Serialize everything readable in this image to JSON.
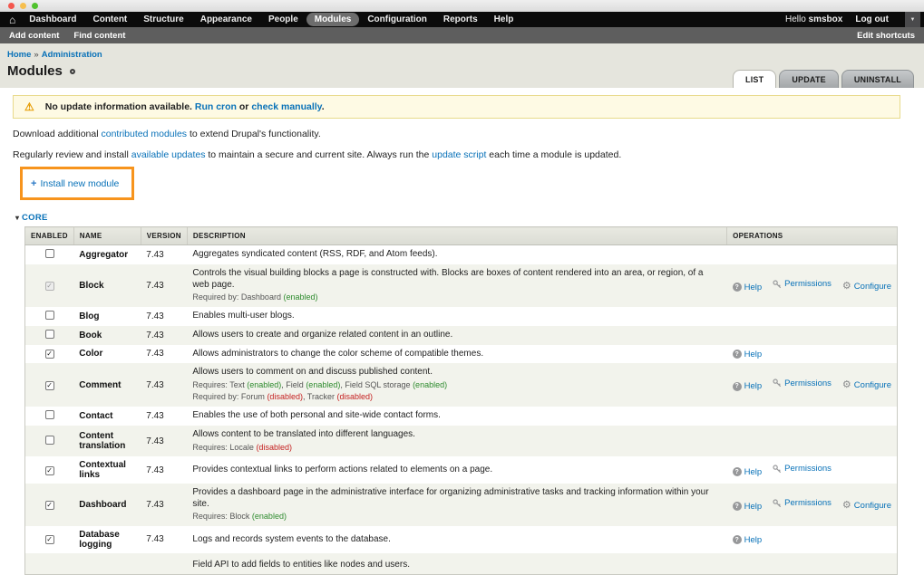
{
  "window": {
    "controls": [
      "close",
      "minimize",
      "maximize"
    ]
  },
  "icons": {
    "home": "⌂",
    "dropdown_caret": "▼",
    "warning": "⚠",
    "breadcrumb_separator": "»",
    "collapse_arrow": "▾",
    "help_glyph": "?",
    "gear_glyph": "⚙",
    "plus": "+"
  },
  "toolbar": {
    "items": [
      {
        "label": "Dashboard",
        "active": false
      },
      {
        "label": "Content",
        "active": false
      },
      {
        "label": "Structure",
        "active": false
      },
      {
        "label": "Appearance",
        "active": false
      },
      {
        "label": "People",
        "active": false
      },
      {
        "label": "Modules",
        "active": true
      },
      {
        "label": "Configuration",
        "active": false
      },
      {
        "label": "Reports",
        "active": false
      },
      {
        "label": "Help",
        "active": false
      }
    ],
    "greeting_prefix": "Hello ",
    "username": "smsbox",
    "logout_label": "Log out"
  },
  "shortcut_bar": {
    "items": [
      "Add content",
      "Find content"
    ],
    "edit_label": "Edit shortcuts"
  },
  "breadcrumb": {
    "items": [
      "Home",
      "Administration"
    ],
    "separator": "»"
  },
  "page": {
    "title": "Modules"
  },
  "tabs": [
    {
      "label": "LIST",
      "active": true
    },
    {
      "label": "UPDATE",
      "active": false
    },
    {
      "label": "UNINSTALL",
      "active": false
    }
  ],
  "warning": {
    "text": "No update information available. ",
    "link1": "Run cron",
    "middle": " or ",
    "link2": "check manually",
    "end": "."
  },
  "intro": {
    "p1_pre": "Download additional ",
    "p1_link": "contributed modules",
    "p1_post": " to extend Drupal's functionality.",
    "p2_pre": "Regularly review and install ",
    "p2_link1": "available updates",
    "p2_mid": " to maintain a secure and current site. Always run the ",
    "p2_link2": "update script",
    "p2_post": " each time a module is updated."
  },
  "install_button": {
    "label": "Install new module"
  },
  "core_section": {
    "label": "CORE",
    "collapsed": false
  },
  "colors": {
    "link_blue": "#0871b8",
    "enabled_green": "#2e8b2e",
    "disabled_red": "#c52222",
    "highlight_orange": "#f7941d",
    "warning_bg": "#fefae4"
  },
  "table": {
    "headers": [
      "ENABLED",
      "NAME",
      "VERSION",
      "DESCRIPTION",
      "OPERATIONS"
    ],
    "operations_icons": {
      "Help": "help-icon",
      "Permissions": "key-icon",
      "Configure": "gear-icon"
    },
    "rows": [
      {
        "name": "Aggregator",
        "version": "7.43",
        "checked": false,
        "disabled": false,
        "description": "Aggregates syndicated content (RSS, RDF, and Atom feeds).",
        "notes": [],
        "operations": []
      },
      {
        "name": "Block",
        "version": "7.43",
        "checked": true,
        "disabled": true,
        "description": "Controls the visual building blocks a page is constructed with. Blocks are boxes of content rendered into an area, or region, of a web page.",
        "notes": [
          [
            {
              "t": "Required by: Dashboard "
            },
            {
              "t": "(enabled)",
              "s": "enabled"
            }
          ]
        ],
        "operations": [
          "Help",
          "Permissions",
          "Configure"
        ]
      },
      {
        "name": "Blog",
        "version": "7.43",
        "checked": false,
        "disabled": false,
        "description": "Enables multi-user blogs.",
        "notes": [],
        "operations": []
      },
      {
        "name": "Book",
        "version": "7.43",
        "checked": false,
        "disabled": false,
        "description": "Allows users to create and organize related content in an outline.",
        "notes": [],
        "operations": []
      },
      {
        "name": "Color",
        "version": "7.43",
        "checked": true,
        "disabled": false,
        "description": "Allows administrators to change the color scheme of compatible themes.",
        "notes": [],
        "operations": [
          "Help"
        ]
      },
      {
        "name": "Comment",
        "version": "7.43",
        "checked": true,
        "disabled": false,
        "description": "Allows users to comment on and discuss published content.",
        "notes": [
          [
            {
              "t": "Requires: Text "
            },
            {
              "t": "(enabled)",
              "s": "enabled"
            },
            {
              "t": ", Field "
            },
            {
              "t": "(enabled)",
              "s": "enabled"
            },
            {
              "t": ", Field SQL storage "
            },
            {
              "t": "(enabled)",
              "s": "enabled"
            }
          ],
          [
            {
              "t": "Required by: Forum "
            },
            {
              "t": "(disabled)",
              "s": "disabled"
            },
            {
              "t": ", Tracker "
            },
            {
              "t": "(disabled)",
              "s": "disabled"
            }
          ]
        ],
        "operations": [
          "Help",
          "Permissions",
          "Configure"
        ]
      },
      {
        "name": "Contact",
        "version": "7.43",
        "checked": false,
        "disabled": false,
        "description": "Enables the use of both personal and site-wide contact forms.",
        "notes": [],
        "operations": []
      },
      {
        "name": "Content translation",
        "version": "7.43",
        "checked": false,
        "disabled": false,
        "description": "Allows content to be translated into different languages.",
        "notes": [
          [
            {
              "t": "Requires: Locale "
            },
            {
              "t": "(disabled)",
              "s": "disabled"
            }
          ]
        ],
        "operations": []
      },
      {
        "name": "Contextual links",
        "version": "7.43",
        "checked": true,
        "disabled": false,
        "description": "Provides contextual links to perform actions related to elements on a page.",
        "notes": [],
        "operations": [
          "Help",
          "Permissions"
        ]
      },
      {
        "name": "Dashboard",
        "version": "7.43",
        "checked": true,
        "disabled": false,
        "description": "Provides a dashboard page in the administrative interface for organizing administrative tasks and tracking information within your site.",
        "notes": [
          [
            {
              "t": "Requires: Block "
            },
            {
              "t": "(enabled)",
              "s": "enabled"
            }
          ]
        ],
        "operations": [
          "Help",
          "Permissions",
          "Configure"
        ]
      },
      {
        "name": "Database logging",
        "version": "7.43",
        "checked": true,
        "disabled": false,
        "description": "Logs and records system events to the database.",
        "notes": [],
        "operations": [
          "Help"
        ]
      },
      {
        "name": "",
        "version": "",
        "checked": null,
        "disabled": false,
        "partial": true,
        "description": "Field API to add fields to entities like nodes and users.",
        "notes": [],
        "operations": []
      }
    ]
  }
}
